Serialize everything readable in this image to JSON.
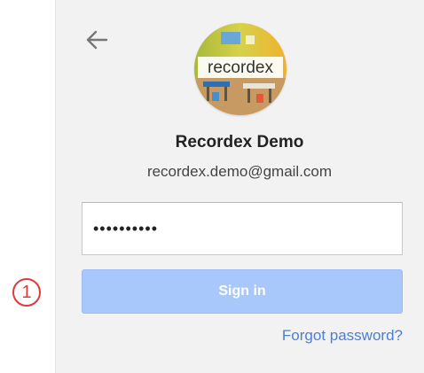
{
  "profile": {
    "name": "Recordex Demo",
    "email": "recordex.demo@gmail.com",
    "avatar_logo_text": "recordex"
  },
  "password": {
    "masked_value": "••••••••••"
  },
  "actions": {
    "signin_label": "Sign in",
    "forgot_label": "Forgot password?"
  },
  "annotation": {
    "step_number": "1"
  },
  "icons": {
    "back": "arrow-back-icon"
  },
  "colors": {
    "signin_button": "#a8c7fa",
    "link": "#4a7fd6",
    "annotation": "#e0393b",
    "card_background": "#f2f2f2"
  }
}
